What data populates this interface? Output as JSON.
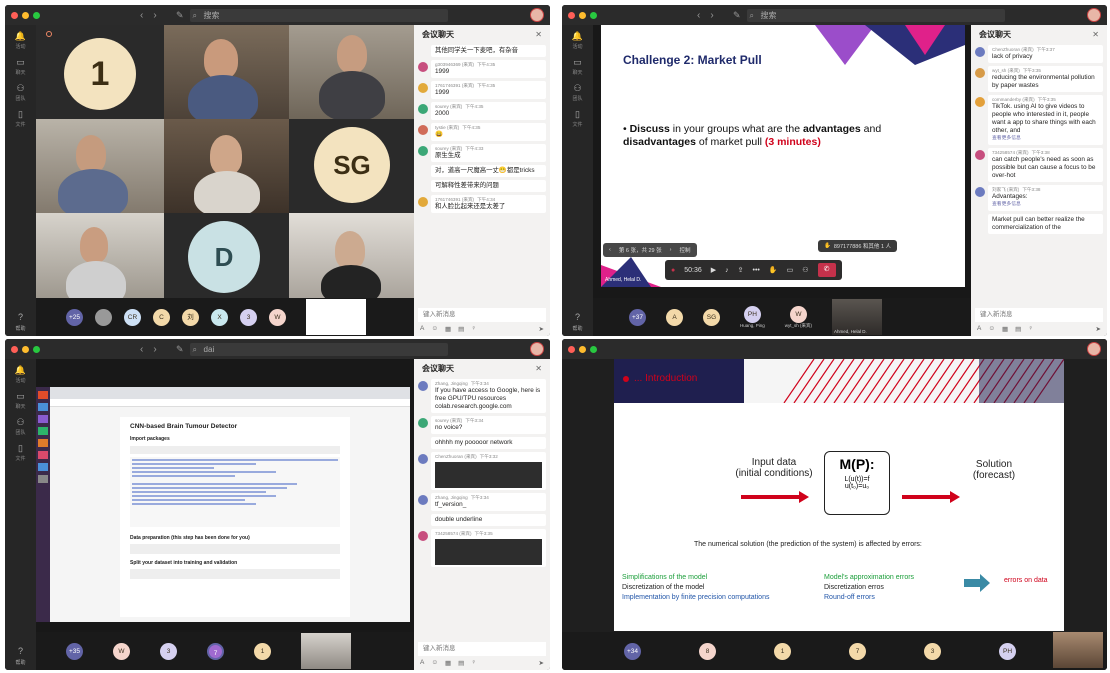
{
  "common": {
    "chat_title": "会议聊天",
    "compose_placeholder": "键入新消息",
    "rail": [
      {
        "icon": "bell-icon",
        "label": "活动"
      },
      {
        "icon": "chat-icon",
        "label": "聊天"
      },
      {
        "icon": "teams-icon",
        "label": "团队"
      },
      {
        "icon": "files-icon",
        "label": "文件"
      }
    ],
    "help_label": "帮助",
    "tools": [
      "A",
      "☺",
      "▦",
      "▤",
      "♀",
      "⊡"
    ]
  },
  "w1": {
    "search": "搜索",
    "tiles": {
      "avatar_1": "1",
      "avatar_sg": "SG",
      "avatar_d": "D"
    },
    "bar": [
      "+25",
      "",
      "CR",
      "C",
      "刘",
      "X",
      "3",
      "W"
    ],
    "messages": [
      {
        "text": "其他同学关一下麦吧，有杂音",
        "color": "",
        "name": "",
        "time": ""
      },
      {
        "name": "g303946369 (来宾)",
        "time": "下午4:35",
        "text": "1999",
        "color": "#c74e7e"
      },
      {
        "name": "1761746391 (来宾)",
        "time": "下午4:35",
        "text": "1999",
        "color": "#e2a93a"
      },
      {
        "name": "sourey (来宾)",
        "time": "下午4:35",
        "text": "2000",
        "color": "#3ba776"
      },
      {
        "name": "tystie (来宾)",
        "time": "下午4:35",
        "text": "😄",
        "color": "#d06b58"
      },
      {
        "name": "sourey (来宾)",
        "time": "下午4:33",
        "text": "原生生成",
        "color": "#3ba776"
      },
      {
        "text": "对，道高一尺魔高一丈😁都是tricks",
        "color": "",
        "name": "",
        "time": ""
      },
      {
        "text": "可解释性差带来的问题",
        "color": "",
        "name": "",
        "time": ""
      },
      {
        "name": "1761746391 (来宾)",
        "time": "下午4:34",
        "text": "和人脸比起来还是太差了",
        "color": "#e2a93a"
      }
    ]
  },
  "w2": {
    "search": "搜索",
    "slide_title": "Challenge 2: Market Pull",
    "bullet_1": "Discuss",
    "bullet_2": " in your groups what are the ",
    "bullet_3": "advantages",
    "bullet_4": " and ",
    "bullet_5": "disadvantages",
    "bullet_6": " of market pull ",
    "bullet_7": "(3 minutes)",
    "page_nav": "第 6 张，共 29 张",
    "control": "控制",
    "raised": "897177886 和其他 1 人",
    "timer": "50:36",
    "presenter": "Ahmed, Helal D.",
    "bar": [
      "+37",
      "A",
      "SG",
      "PH",
      "W"
    ],
    "bar_names": [
      "Huang, Ping",
      "wyt_sh (来宾)",
      "Ahmed, Helal D."
    ],
    "messages": [
      {
        "name": "ChenZhuoran (来宾)",
        "time": "下午3:37",
        "text": "lack of privacy",
        "color": "#6c7bbf"
      },
      {
        "name": "wyt_sh (来宾)",
        "time": "下午3:35",
        "text": "reducing the environmental pollution by paper wastes",
        "color": "#d79b48"
      },
      {
        "name": "commanderby (来宾)",
        "time": "下午3:35",
        "text": "TikTok. using AI to give videos to people who interested in it, people want a app to share things with each other, and",
        "color": "#e3a03a"
      },
      {
        "name": "734258574 (来宾)",
        "time": "下午3:38",
        "text": "can catch people's need as soon as possible but can cause a focus to be over-hot",
        "color": "#c74e7e"
      },
      {
        "name": "刘家飞 (来宾)",
        "time": "下午3:38",
        "text": "Advantages:",
        "color": "#6c7bbf"
      },
      {
        "text": "Market pull can better realize the commercialization of the",
        "color": "",
        "name": "",
        "time": ""
      }
    ],
    "more_label": "查看更多信息"
  },
  "w3": {
    "search": "dai",
    "doc_title": "CNN-based Brain Tumour Detector",
    "h_import": "Import packages",
    "h_prep": "Data preparation (this step has been done for you)",
    "h_split": "Split your dataset into training and validation",
    "bar": [
      "+35",
      "W",
      "3",
      "7",
      "1"
    ],
    "messages": [
      {
        "name": "Zhang, Jingqing",
        "time": "下午3:34",
        "text": "If you have access to Google, here is free GPU/TPU resources colab.research.google.com",
        "color": "#6c7bbf"
      },
      {
        "name": "sourey (来宾)",
        "time": "下午3:34",
        "text": "no voice?",
        "color": "#3ba776"
      },
      {
        "text": "ohhhh my pooooor network",
        "color": "",
        "name": "",
        "time": ""
      },
      {
        "name": "ChenZhuoran (来宾)",
        "time": "下午3:32",
        "text": "",
        "color": "#6c7bbf"
      },
      {
        "name": "Zhang, Jingqing",
        "time": "下午3:34",
        "text": "tf_version_",
        "color": "#6c7bbf"
      },
      {
        "text": "double underline",
        "color": "",
        "name": "",
        "time": ""
      },
      {
        "name": "734258574 (来宾)",
        "time": "下午3:35",
        "text": "",
        "color": "#c74e7e"
      }
    ]
  },
  "w4": {
    "slide_title": "... Introduction",
    "input": "Input data",
    "input2": "(initial conditions)",
    "model": "M(P):",
    "eq1": "L(u(t))=f",
    "eq2": "u(t₀)=u₀",
    "solution": "Solution",
    "solution2": "(forecast)",
    "caption": "The numerical solution (the prediction of the system) is affected by errors:",
    "left_list": [
      "Simplifications of the model",
      "Discretization of the  model",
      "Implementation by finite precision computations"
    ],
    "right_list": [
      "Model's approximation errors",
      "Discretization erros",
      "Round-off errors"
    ],
    "errors": "errors on data",
    "bar": [
      "+34",
      "8",
      "1",
      "7",
      "3",
      "PH"
    ]
  },
  "colors": {
    "accent": "#6264a7",
    "hangup": "#c4314b",
    "slide_red": "#d0021b"
  }
}
